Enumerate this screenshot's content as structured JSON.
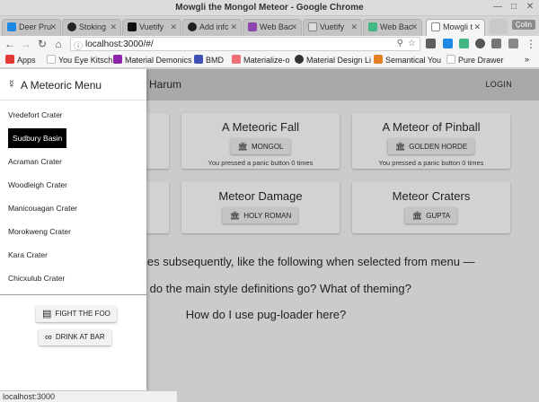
{
  "window": {
    "title": "Mowgli the Mongol Meteor - Google Chrome"
  },
  "tabs": [
    {
      "label": "Deer Pru",
      "color": "#1e88e5"
    },
    {
      "label": "Stoking",
      "color": "#222222"
    },
    {
      "label": "Vuetify",
      "color": "#111111"
    },
    {
      "label": "Add infc",
      "color": "#222222"
    },
    {
      "label": "Web Bac",
      "color": "#8e44ad"
    },
    {
      "label": "Vuetify",
      "color": "#777777"
    },
    {
      "label": "Web Bac",
      "color": "#41b883"
    },
    {
      "label": "Mowgli t",
      "color": "#bbbbbb"
    }
  ],
  "profile": "Çolin",
  "address": {
    "url": "localhost:3000/#/"
  },
  "bookmarks": [
    {
      "label": "Apps",
      "color": "#e53935"
    },
    {
      "label": "You Eye Kitsch",
      "color": "#ffffff"
    },
    {
      "label": "Material Demonics",
      "color": "#8e24aa"
    },
    {
      "label": "BMD",
      "color": "#3f51b5"
    },
    {
      "label": "Materialize-o",
      "color": "#ee6e73"
    },
    {
      "label": "Material Design Li",
      "color": "#333333"
    },
    {
      "label": "Semantical You",
      "color": "#e67e22"
    },
    {
      "label": "Pure Drawer",
      "color": "#ffffff"
    }
  ],
  "appbar": {
    "title": "Harum",
    "login": "LOGIN"
  },
  "drawer": {
    "title": "A Meteoric Menu",
    "items": [
      "Vredefort Crater",
      "Sudbury Basin",
      "Acraman Crater",
      "Woodleigh Crater",
      "Manicouagan Crater",
      "Morokweng Crater",
      "Kara Crater",
      "Chicxulub Crater"
    ],
    "selected_index": 1,
    "buttons": {
      "fight": "FIGHT THE FOO",
      "drink": "DRINK AT BAR"
    }
  },
  "cards": {
    "fall": {
      "title": "A Meteoric Fall",
      "button": "MONGOL",
      "status": "You pressed a panic button 0 times"
    },
    "pinball": {
      "title": "A Meteor of Pinball",
      "button": "GOLDEN HORDE",
      "status": "You pressed a panic button 0 times"
    },
    "damage": {
      "title": "Meteor Damage",
      "button": "HOLY ROMAN"
    },
    "craters": {
      "title": "Meteor Craters",
      "button": "GUPTA"
    }
  },
  "body": {
    "line1": "comes subsequently, like the following when selected from menu —",
    "line2": "ere do the main style definitions go? What of theming?",
    "line3": "How do I use pug-loader here?"
  },
  "status_url": "localhost:3000"
}
